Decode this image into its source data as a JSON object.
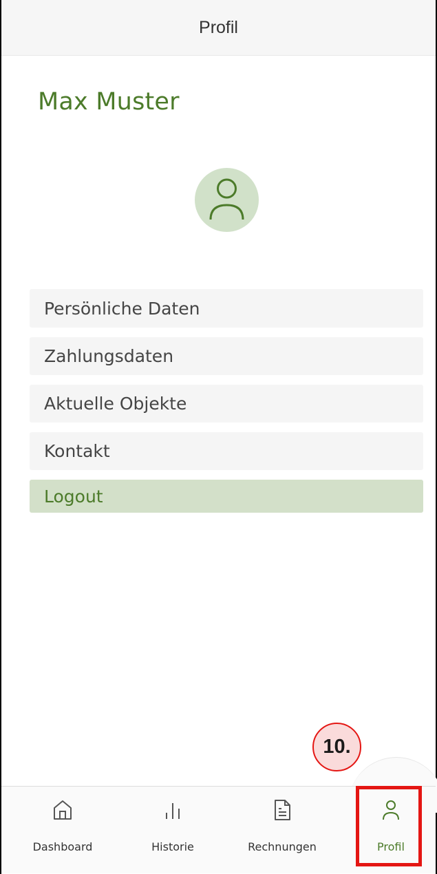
{
  "header": {
    "title": "Profil"
  },
  "profile": {
    "name": "Max Muster"
  },
  "menu": {
    "items": [
      {
        "label": "Persönliche Daten"
      },
      {
        "label": "Zahlungsdaten"
      },
      {
        "label": "Aktuelle Objekte"
      },
      {
        "label": "Kontakt"
      }
    ],
    "logout_label": "Logout"
  },
  "tabbar": {
    "tabs": [
      {
        "label": "Dashboard",
        "icon": "home-icon"
      },
      {
        "label": "Historie",
        "icon": "bar-chart-icon"
      },
      {
        "label": "Rechnungen",
        "icon": "document-icon"
      },
      {
        "label": "Profil",
        "icon": "user-icon",
        "active": true
      }
    ]
  },
  "annotation": {
    "step": "10."
  },
  "colors": {
    "accent": "#4c7b2a",
    "avatar_bg": "#d1e1c9",
    "logout_bg": "#d3e0c9",
    "annotation": "#e41613"
  }
}
